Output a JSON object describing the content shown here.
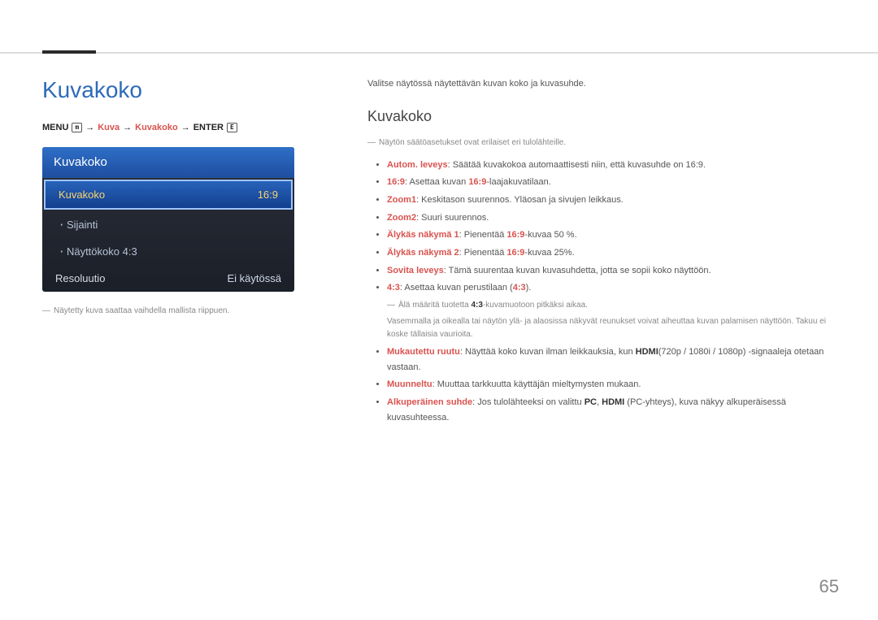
{
  "page_number": "65",
  "main_title": "Kuvakoko",
  "menu_path": {
    "prefix": "MENU",
    "icon1": "m",
    "arrow": "→",
    "seg1": "Kuva",
    "seg2": "Kuvakoko",
    "seg3": "ENTER",
    "icon2": "E"
  },
  "panel": {
    "header": "Kuvakoko",
    "rows": [
      {
        "label": "Kuvakoko",
        "value": "16:9",
        "type": "selected"
      },
      {
        "label": "Sijainti",
        "value": "",
        "type": "sub"
      },
      {
        "label": "Näyttökoko 4:3",
        "value": "",
        "type": "sub"
      },
      {
        "label": "Resoluutio",
        "value": "Ei käytössä",
        "type": "normal"
      }
    ]
  },
  "left_footnote": "Näytetty kuva saattaa vaihdella mallista riippuen.",
  "intro": "Valitse näytössä näytettävän kuvan koko ja kuvasuhde.",
  "section_title": "Kuvakoko",
  "note_top": "Näytön säätöasetukset ovat erilaiset eri tulolähteille.",
  "bullets": [
    {
      "term": "Autom. leveys",
      "text": ": Säätää kuvakokoa automaattisesti niin, että kuvasuhde on 16:9."
    },
    {
      "term": "16:9",
      "text": ": Asettaa kuvan ",
      "term2": "16:9",
      "text2": "-laajakuvatilaan."
    },
    {
      "term": "Zoom1",
      "text": ": Keskitason suurennos. Yläosan ja sivujen leikkaus."
    },
    {
      "term": "Zoom2",
      "text": ": Suuri suurennos."
    },
    {
      "term": "Älykäs näkymä 1",
      "text": ": Pienentää ",
      "term2": "16:9",
      "text2": "-kuvaa 50 %."
    },
    {
      "term": "Älykäs näkymä 2",
      "text": ": Pienentää ",
      "term2": "16:9",
      "text2": "-kuvaa 25%."
    },
    {
      "term": "Sovita leveys",
      "text": ": Tämä suurentaa kuvan kuvasuhdetta, jotta se sopii koko näyttöön."
    },
    {
      "term": "4:3",
      "text": ": Asettaa kuvan perustilaan (",
      "term2": "4:3",
      "text2": ").",
      "subnote": {
        "line1": "Älä määritä tuotetta ",
        "em": "4:3",
        "line1b": "-kuvamuotoon pitkäksi aikaa.",
        "line2": "Vasemmalla ja oikealla tai näytön ylä- ja alaosissa näkyvät reunukset voivat aiheuttaa kuvan palamisen näyttöön. Takuu ei koske tällaisia vaurioita."
      }
    },
    {
      "term": "Mukautettu ruutu",
      "text": ": Näyttää koko kuvan ilman leikkauksia, kun ",
      "strong": "HDMI",
      "text2": "(720p / 1080i / 1080p) -signaaleja otetaan vastaan."
    },
    {
      "term": "Muunneltu",
      "text": ": Muuttaa tarkkuutta käyttäjän mieltymysten mukaan."
    },
    {
      "term": "Alkuperäinen suhde",
      "text": ": Jos tulolähteeksi on valittu ",
      "strong": "PC",
      "text2": ", ",
      "strong2": "HDMI",
      "text3": " (PC-yhteys), kuva näkyy alkuperäisessä kuvasuhteessa."
    }
  ]
}
